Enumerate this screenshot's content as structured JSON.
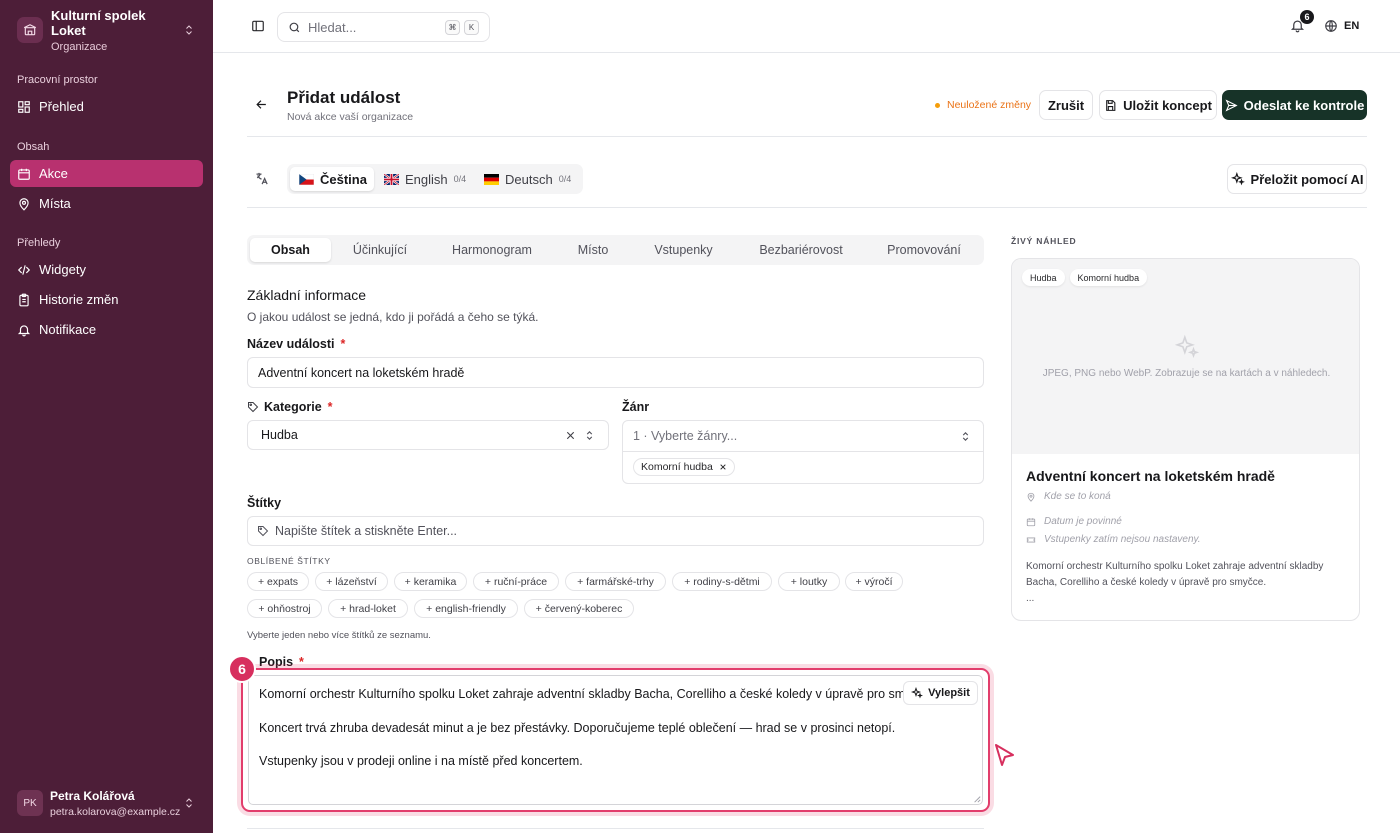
{
  "sidebar": {
    "org_name": "Kulturní spolek Loket",
    "org_sub": "Organizace",
    "sections": {
      "workspace": "Pracovní prostor",
      "content": "Obsah",
      "reports": "Přehledy"
    },
    "items": {
      "overview": "Přehled",
      "events": "Akce",
      "places": "Místa",
      "widgets": "Widgety",
      "history": "Historie změn",
      "notifications": "Notifikace"
    },
    "user": {
      "initials": "PK",
      "name": "Petra Kolářová",
      "email": "petra.kolarova@example.cz"
    }
  },
  "topbar": {
    "search_placeholder": "Hledat...",
    "kbd": [
      "⌘",
      "K"
    ],
    "notification_count": "6",
    "language": "EN"
  },
  "header": {
    "title": "Přidat událost",
    "subtitle": "Nová akce vaší organizace",
    "unsaved": "Neuložené změny",
    "cancel": "Zrušit",
    "save_draft": "Uložit koncept",
    "submit": "Odeslat ke kontrole"
  },
  "lang_tabs": [
    {
      "label": "Čeština",
      "count": ""
    },
    {
      "label": "English",
      "count": "0/4"
    },
    {
      "label": "Deutsch",
      "count": "0/4"
    }
  ],
  "translate_ai": "Přeložit pomocí AI",
  "form_tabs": [
    "Obsah",
    "Účinkující",
    "Harmonogram",
    "Místo",
    "Vstupenky",
    "Bezbariérovost",
    "Promovování"
  ],
  "form": {
    "section_title": "Základní informace",
    "section_sub": "O jakou událost se jedná, kdo ji pořádá a čeho se týká.",
    "name_label": "Název události",
    "name_value": "Adventní koncert na loketském hradě",
    "required_mark": "*",
    "category_label": "Kategorie",
    "category_value": "Hudba",
    "genre_label": "Žánr",
    "genre_placeholder": "1 · Vyberte žánry...",
    "genre_chip": "Komorní hudba",
    "tags_label": "Štítky",
    "tags_placeholder": "Napište štítek a stiskněte Enter...",
    "fav_tags_title": "OBLÍBENÉ ŠTÍTKY",
    "fav_tags": [
      "+ expats",
      "+ lázeňství",
      "+ keramika",
      "+ ruční-práce",
      "+ farmářské-trhy",
      "+ rodiny-s-dětmi",
      "+ loutky",
      "+ výročí",
      "+ ohňostroj",
      "+ hrad-loket",
      "+ english-friendly",
      "+ červený-koberec"
    ],
    "tags_hint": "Vyberte jeden nebo více štítků ze seznamu.",
    "desc_label": "Popis",
    "desc_paragraphs": [
      "Komorní orchestr Kulturního spolku Loket zahraje adventní skladby Bacha, Corelliho a české koledy v úpravě pro smyčce.",
      "Koncert trvá zhruba devadesát minut a je bez přestávky. Doporučujeme teplé oblečení — hrad se v prosinci netopí.",
      "Vstupenky jsou v prodeji online i na místě před koncertem."
    ],
    "improve": "Vylepšit",
    "step_badge": "6"
  },
  "preview": {
    "label": "ŽIVÝ NÁHLED",
    "chips": [
      "Hudba",
      "Komorní hudba"
    ],
    "image_hint": "JPEG, PNG nebo WebP. Zobrazuje se na kartách a v náhledech.",
    "title": "Adventní koncert na loketském hradě",
    "place": "Kde se to koná",
    "date": "Datum je povinné",
    "tickets": "Vstupenky zatím nejsou nastaveny.",
    "desc": "Komorní orchestr Kulturního spolku Loket zahraje adventní skladby Bacha, Corelliho a české koledy v úpravě pro smyčce.",
    "more": "..."
  },
  "colors": {
    "sidebar_bg": "#4d1e38",
    "accent": "#b8316f",
    "primary_button": "#173328",
    "warning": "#ea7317",
    "focus_ring": "#e23d6c"
  }
}
